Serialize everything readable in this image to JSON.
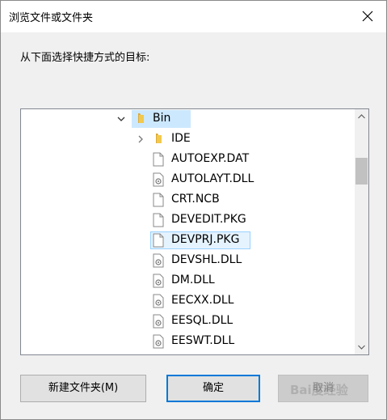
{
  "window": {
    "title": "浏览文件或文件夹",
    "close_icon": "close-icon"
  },
  "instruction": "从下面选择快捷方式的目标:",
  "tree": {
    "folder_color": "#e8b84a",
    "items": [
      {
        "label": "Bin",
        "type": "folder",
        "expanded": true,
        "selected": true
      },
      {
        "label": "IDE",
        "type": "folder",
        "expanded": false
      },
      {
        "label": "AUTOEXP.DAT",
        "type": "file"
      },
      {
        "label": "AUTOLAYT.DLL",
        "type": "dll"
      },
      {
        "label": "CRT.NCB",
        "type": "file"
      },
      {
        "label": "DEVEDIT.PKG",
        "type": "file"
      },
      {
        "label": "DEVPRJ.PKG",
        "type": "file",
        "focused": true
      },
      {
        "label": "DEVSHL.DLL",
        "type": "dll"
      },
      {
        "label": "DM.DLL",
        "type": "dll"
      },
      {
        "label": "EECXX.DLL",
        "type": "dll"
      },
      {
        "label": "EESQL.DLL",
        "type": "dll"
      },
      {
        "label": "EESWT.DLL",
        "type": "dll"
      }
    ]
  },
  "buttons": {
    "new_folder": "新建文件夹(M)",
    "ok": "确定",
    "cancel": "取消"
  },
  "watermark": "Bai度经验"
}
